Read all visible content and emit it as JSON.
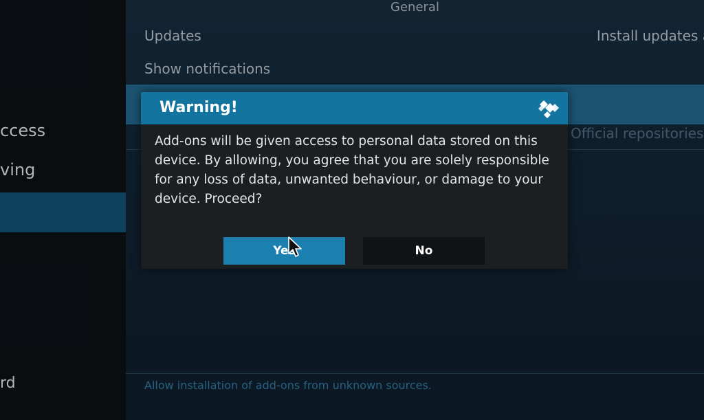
{
  "sidebar": {
    "items": [
      {
        "label": "ccess"
      },
      {
        "label": "ving"
      },
      {
        "label": "rd"
      }
    ]
  },
  "main": {
    "section_title": "General",
    "rows": [
      {
        "name": "Updates",
        "value": "Install updates a"
      },
      {
        "name": "Show notifications",
        "value": ""
      },
      {
        "name": "",
        "value": "Official repositories o"
      }
    ],
    "help_text": "Allow installation of add-ons from unknown sources."
  },
  "dialog": {
    "title": "Warning!",
    "message": "Add-ons will be given access to personal data stored on this device. By allowing, you agree that you are solely responsible for any loss of data, unwanted behaviour, or damage to your device. Proceed?",
    "yes_label": "Yes",
    "no_label": "No",
    "logo_icon": "kodi-logo-icon"
  },
  "colors": {
    "accent": "#12749f",
    "button_focus": "#1b7fb0",
    "sidebar_selected": "#0f4a6a",
    "row_highlight": "#1f5f80",
    "help_text": "#2f6f93"
  }
}
